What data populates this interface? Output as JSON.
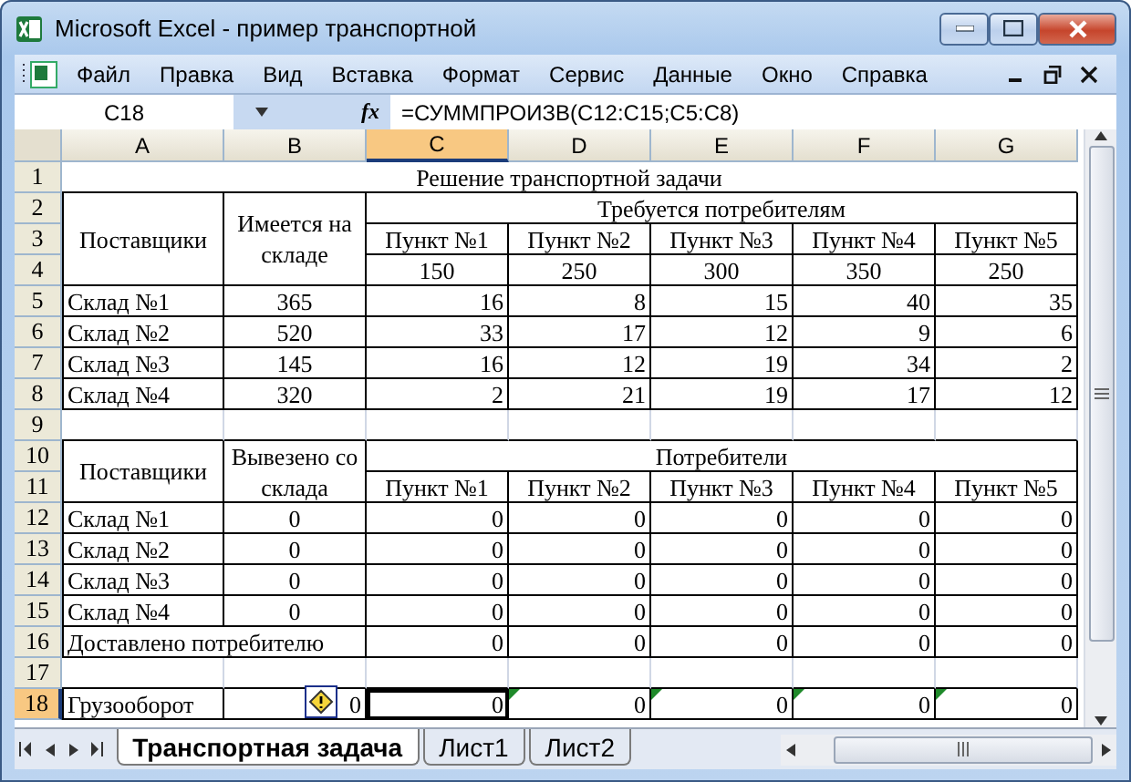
{
  "window": {
    "title": "Microsoft Excel - пример транспортной"
  },
  "menu": [
    "Файл",
    "Правка",
    "Вид",
    "Вставка",
    "Формат",
    "Сервис",
    "Данные",
    "Окно",
    "Справка"
  ],
  "formula_bar": {
    "name_box": "C18",
    "function_button": "fx",
    "formula": "=СУММПРОИЗВ(C12:C15;C5:C8)"
  },
  "columns": [
    {
      "label": "A",
      "selected": false
    },
    {
      "label": "B",
      "selected": false
    },
    {
      "label": "C",
      "selected": true
    },
    {
      "label": "D",
      "selected": false
    },
    {
      "label": "E",
      "selected": false
    },
    {
      "label": "F",
      "selected": false
    },
    {
      "label": "G",
      "selected": false
    }
  ],
  "rows": [
    {
      "number": "1",
      "selected": false
    },
    {
      "number": "2",
      "selected": false
    },
    {
      "number": "3",
      "selected": false
    },
    {
      "number": "4",
      "selected": false
    },
    {
      "number": "5",
      "selected": false
    },
    {
      "number": "6",
      "selected": false
    },
    {
      "number": "7",
      "selected": false
    },
    {
      "number": "8",
      "selected": false
    },
    {
      "number": "9",
      "selected": false
    },
    {
      "number": "10",
      "selected": false
    },
    {
      "number": "11",
      "selected": false
    },
    {
      "number": "12",
      "selected": false
    },
    {
      "number": "13",
      "selected": false
    },
    {
      "number": "14",
      "selected": false
    },
    {
      "number": "15",
      "selected": false
    },
    {
      "number": "16",
      "selected": false
    },
    {
      "number": "17",
      "selected": false
    },
    {
      "number": "18",
      "selected": true
    }
  ],
  "title": "Решение транспортной задачи",
  "supply_table": {
    "supplier_header": "Поставщики",
    "stock_header": "Имеется на складе",
    "demand_header": "Требуется потребителям",
    "points": [
      "Пункт №1",
      "Пункт №2",
      "Пункт №3",
      "Пункт №4",
      "Пункт №5"
    ],
    "demands": [
      "150",
      "250",
      "300",
      "350",
      "250"
    ],
    "rows": [
      {
        "name": "Склад №1",
        "stock": "365",
        "costs": [
          "16",
          "8",
          "15",
          "40",
          "35"
        ]
      },
      {
        "name": "Склад №2",
        "stock": "520",
        "costs": [
          "33",
          "17",
          "12",
          "9",
          "6"
        ]
      },
      {
        "name": "Склад №3",
        "stock": "145",
        "costs": [
          "16",
          "12",
          "19",
          "34",
          "2"
        ]
      },
      {
        "name": "Склад №4",
        "stock": "320",
        "costs": [
          "2",
          "21",
          "19",
          "17",
          "12"
        ]
      }
    ]
  },
  "shipment_table": {
    "supplier_header": "Поставщики",
    "shipped_header": "Вывезено со склада",
    "consumers_header": "Потребители",
    "points": [
      "Пункт №1",
      "Пункт №2",
      "Пункт №3",
      "Пункт №4",
      "Пункт №5"
    ],
    "rows": [
      {
        "name": "Склад №1",
        "shipped": "0",
        "amounts": [
          "0",
          "0",
          "0",
          "0",
          "0"
        ]
      },
      {
        "name": "Склад №2",
        "shipped": "0",
        "amounts": [
          "0",
          "0",
          "0",
          "0",
          "0"
        ]
      },
      {
        "name": "Склад №3",
        "shipped": "0",
        "amounts": [
          "0",
          "0",
          "0",
          "0",
          "0"
        ]
      },
      {
        "name": "Склад №4",
        "shipped": "0",
        "amounts": [
          "0",
          "0",
          "0",
          "0",
          "0"
        ]
      }
    ],
    "total": {
      "label": "Доставлено потребителю",
      "values": [
        "0",
        "0",
        "0",
        "0",
        "0"
      ]
    }
  },
  "turnover": {
    "label": "Грузооборот",
    "value": {
      "text": "0",
      "warning": true
    },
    "values": [
      {
        "text": "0",
        "selected": true,
        "error_flag": false
      },
      {
        "text": "0",
        "selected": false,
        "error_flag": true
      },
      {
        "text": "0",
        "selected": false,
        "error_flag": true
      },
      {
        "text": "0",
        "selected": false,
        "error_flag": true
      },
      {
        "text": "0",
        "selected": false,
        "error_flag": true
      }
    ]
  },
  "sheet_tabs": [
    {
      "label": "Транспортная задача",
      "selected": true
    },
    {
      "label": "Лист1",
      "selected": false
    },
    {
      "label": "Лист2",
      "selected": false
    }
  ]
}
